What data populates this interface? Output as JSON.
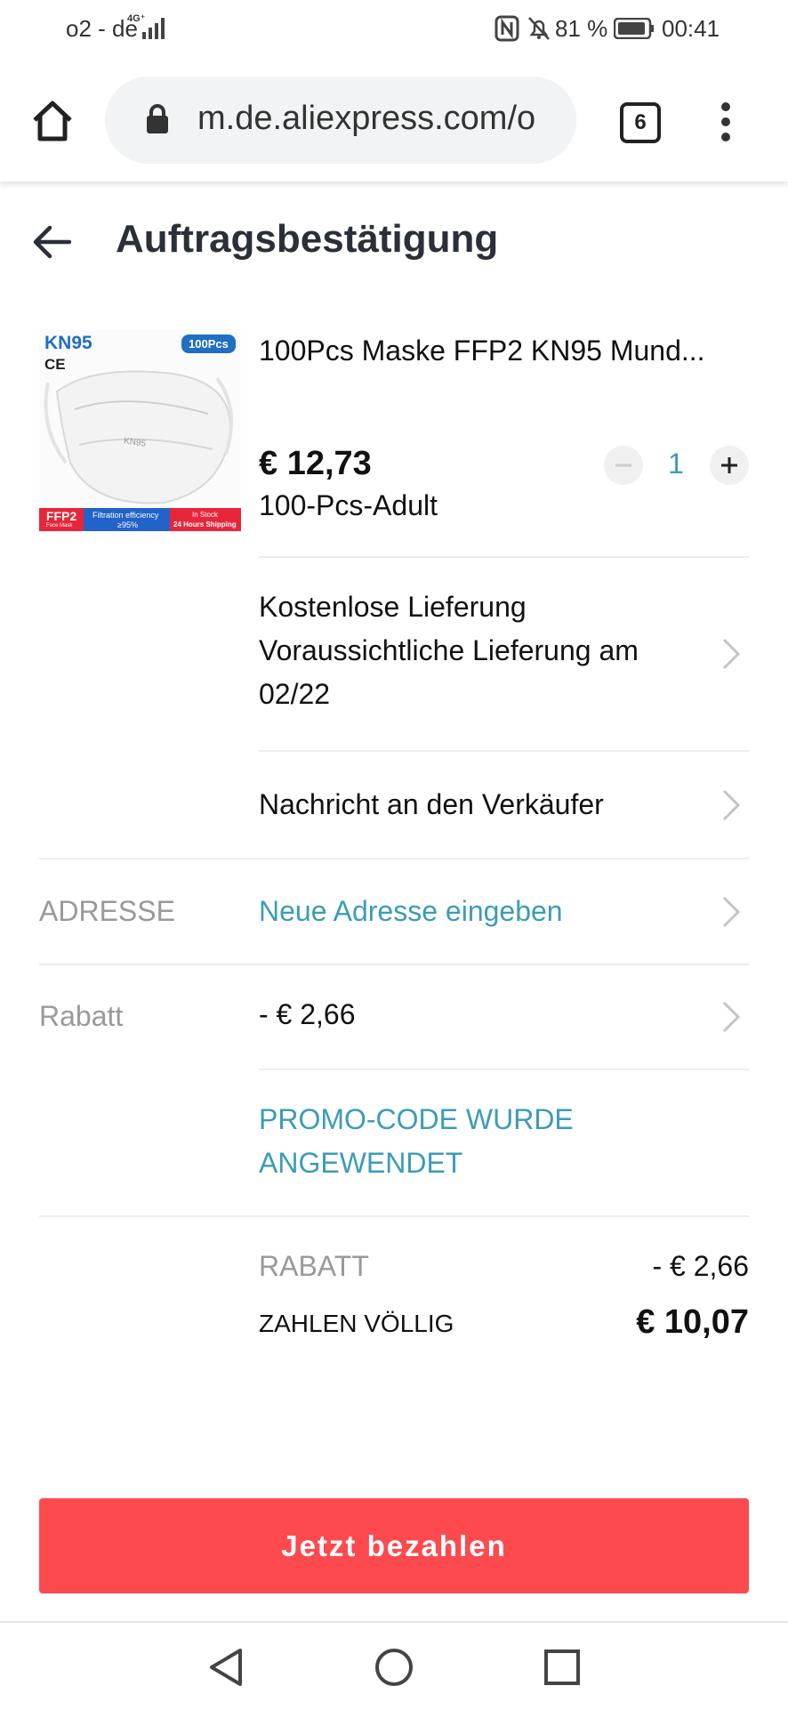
{
  "status_bar": {
    "carrier": "o2 - de",
    "network": "4G⁺",
    "battery": "81 %",
    "time": "00:41"
  },
  "browser": {
    "url": "m.de.aliexpress.com/o",
    "tab_count": "6"
  },
  "header": {
    "title": "Auftragsbestätigung"
  },
  "product": {
    "name": "100Pcs Maske FFP2 KN95 Mund...",
    "price": "€ 12,73",
    "variant": "100-Pcs-Adult",
    "quantity": "1",
    "image_labels": {
      "kn95": "KN95",
      "ce": "CE",
      "pcs": "100Pcs",
      "mask_print": "KN95",
      "ffp2": "FFP2",
      "face_mask": "Face Mask",
      "filtration": "Filtration efficiency",
      "efficiency": "≥95%",
      "in_stock": "In Stock",
      "shipping": "24 Hours Shipping"
    }
  },
  "delivery": {
    "line1": "Kostenlose Lieferung",
    "line2": "Voraussichtliche Lieferung am",
    "line3": "02/22"
  },
  "message": {
    "label": "Nachricht an den Verkäufer"
  },
  "address": {
    "label": "ADRESSE",
    "value": "Neue Adresse eingeben"
  },
  "discount": {
    "label": "Rabatt",
    "value": "- € 2,66"
  },
  "promo": {
    "line1": "PROMO-CODE WURDE",
    "line2": "ANGEWENDET"
  },
  "summary": {
    "discount_label": "RABATT",
    "discount_value": "- € 2,66",
    "total_label": "ZAHLEN VÖLLIG",
    "total_value": "€ 10,07"
  },
  "pay_button": {
    "label": "Jetzt bezahlen"
  },
  "colors": {
    "accent_red": "#fc4a4f",
    "link_teal": "#3b9cb8"
  }
}
